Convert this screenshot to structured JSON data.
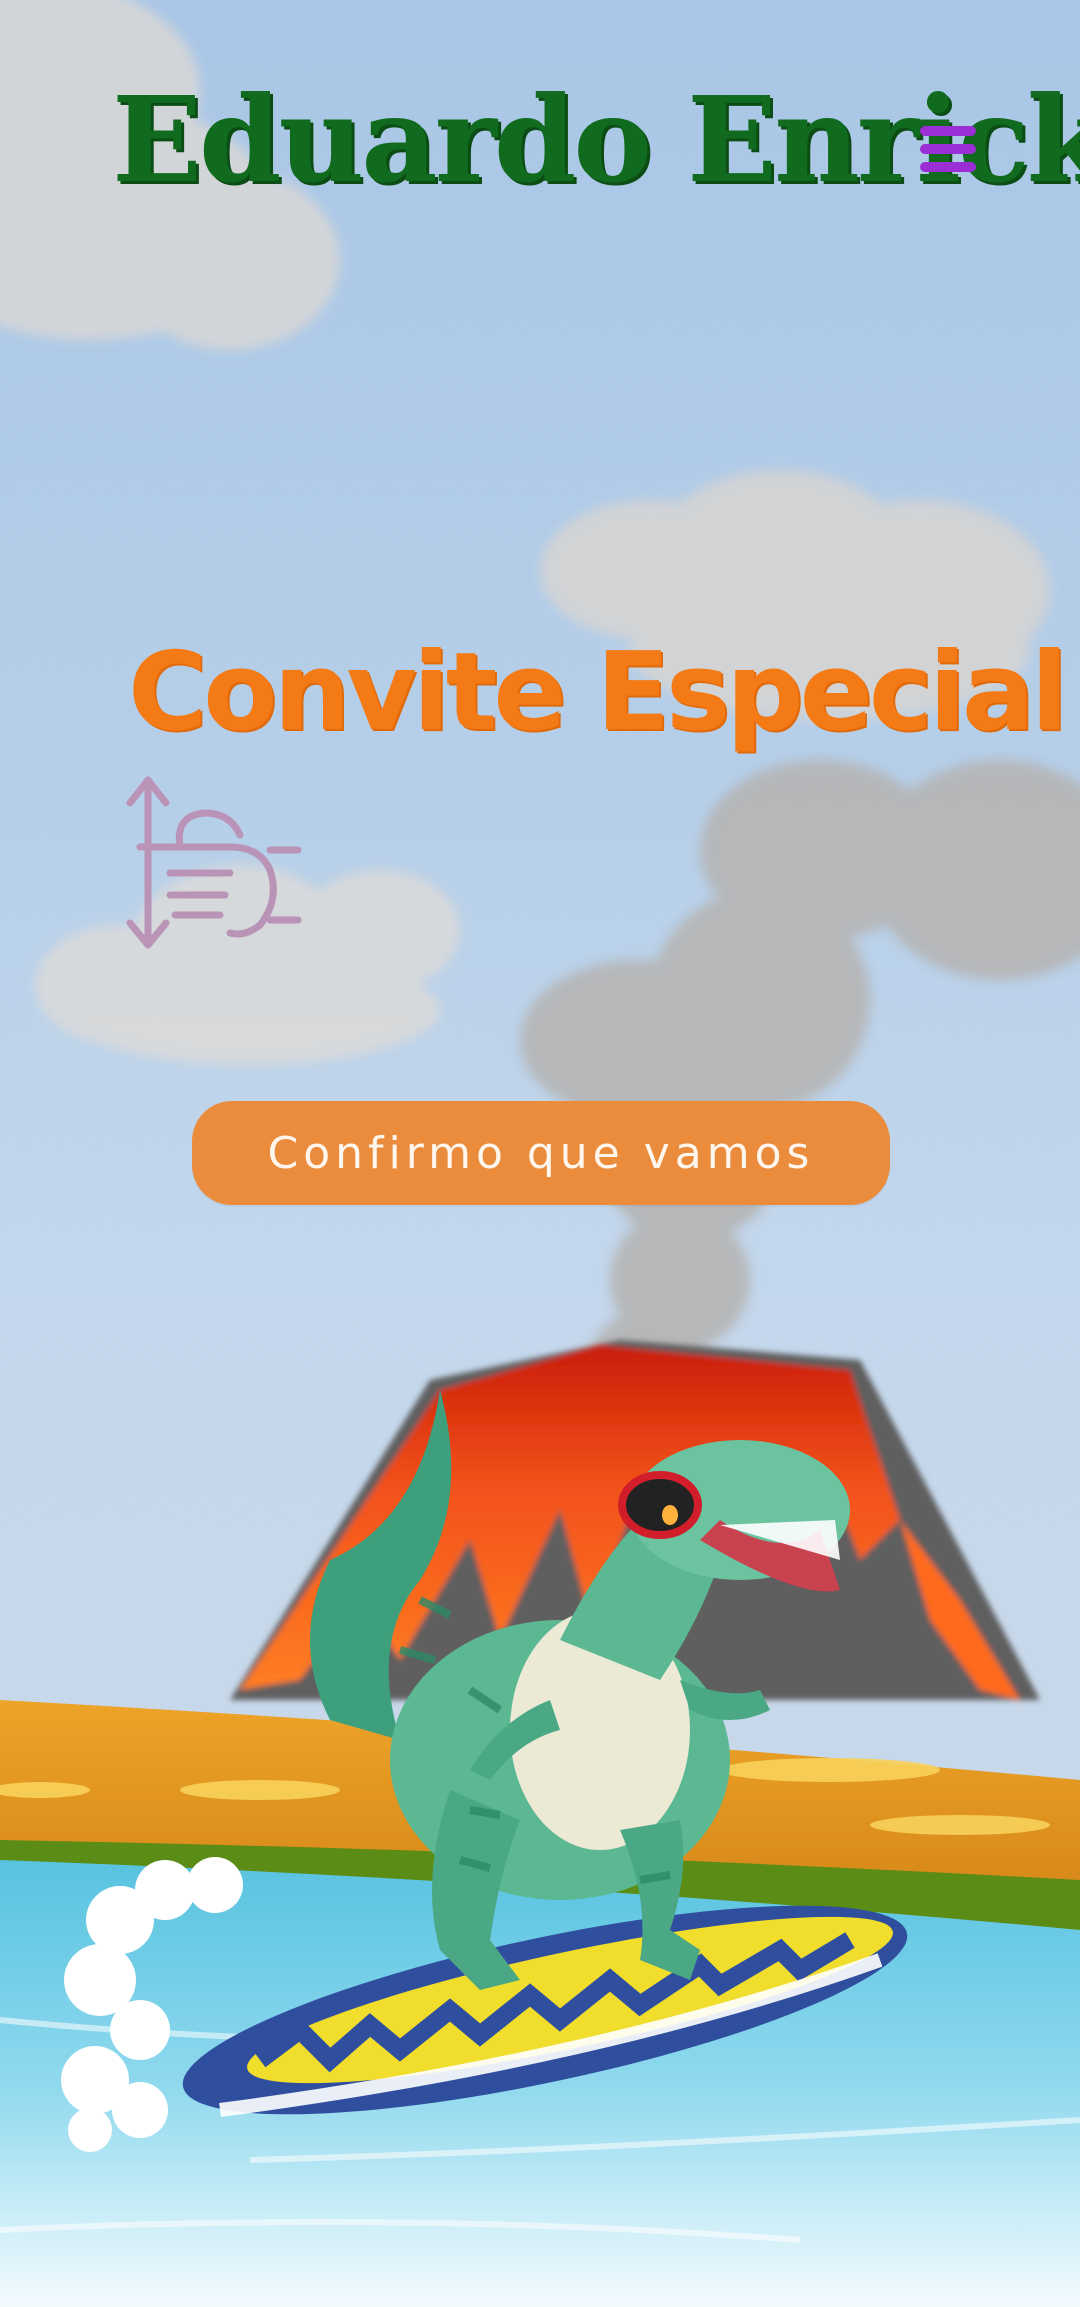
{
  "header": {
    "title": "Eduardo Enrick",
    "menu_icon": "hamburger-menu-icon"
  },
  "hero": {
    "headline": "Convite Especial",
    "scroll_hint_icon": "swipe-vertical-hand-icon",
    "cta_label": "Confirmo que vamos"
  },
  "colors": {
    "title": "#116b1f",
    "menu": "#9c2ed6",
    "headline": "#f47a16",
    "cta_background": "#ea8c3c",
    "sky": "#a9c6e6"
  },
  "illustration": {
    "scene_icons": [
      "cloud-icon",
      "volcano-icon",
      "dinosaur-surfing-icon",
      "surfboard-icon",
      "sea-wave-icon",
      "beach-sand-icon"
    ]
  }
}
